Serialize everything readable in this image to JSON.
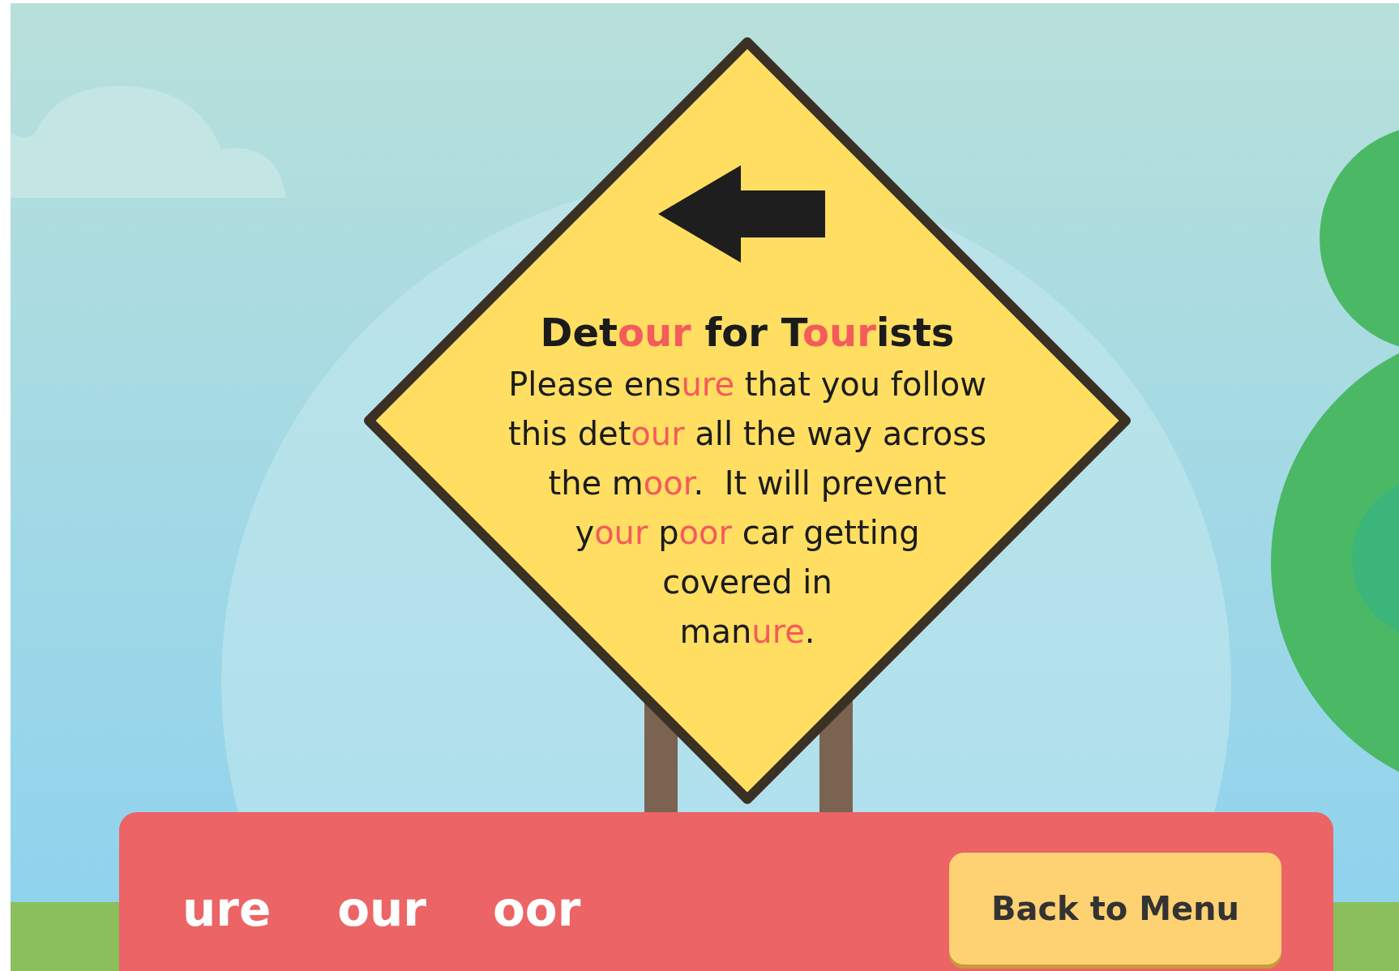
{
  "sign": {
    "title": [
      {
        "text": "Det",
        "highlight": false
      },
      {
        "text": "our",
        "highlight": true
      },
      {
        "text": " for T",
        "highlight": false
      },
      {
        "text": "our",
        "highlight": true
      },
      {
        "text": "ists",
        "highlight": false
      }
    ],
    "lines": [
      [
        {
          "text": "Please ens",
          "highlight": false
        },
        {
          "text": "ure",
          "highlight": true
        },
        {
          "text": " that you follow",
          "highlight": false
        }
      ],
      [
        {
          "text": "this det",
          "highlight": false
        },
        {
          "text": "our",
          "highlight": true
        },
        {
          "text": " all the way across",
          "highlight": false
        }
      ],
      [
        {
          "text": "the m",
          "highlight": false
        },
        {
          "text": "oor",
          "highlight": true
        },
        {
          "text": ".  It will prevent",
          "highlight": false
        }
      ],
      [
        {
          "text": "y",
          "highlight": false
        },
        {
          "text": "our",
          "highlight": true
        },
        {
          "text": " p",
          "highlight": false
        },
        {
          "text": "oor",
          "highlight": true
        },
        {
          "text": " car getting",
          "highlight": false
        }
      ],
      [
        {
          "text": "covered in",
          "highlight": false
        }
      ],
      [
        {
          "text": "man",
          "highlight": false
        },
        {
          "text": "ure",
          "highlight": true
        },
        {
          "text": ".",
          "highlight": false
        }
      ]
    ]
  },
  "tiles": [
    "ure",
    "our",
    "oor"
  ],
  "back_button": "Back to Menu"
}
